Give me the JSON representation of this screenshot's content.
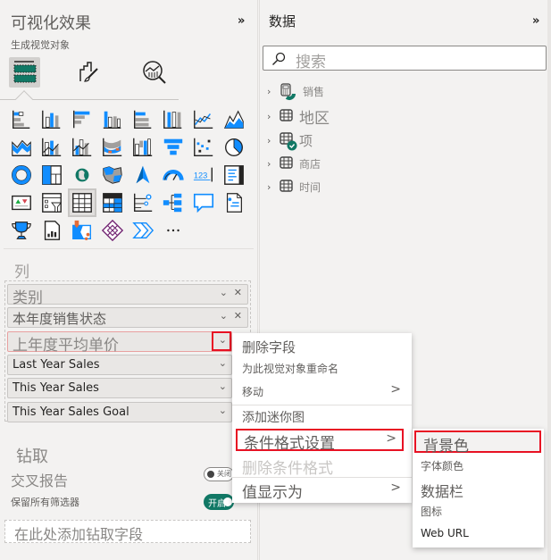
{
  "viz_pane": {
    "title": "可视化效果",
    "subtitle": "生成视觉对象",
    "collapse_icon": "»",
    "tabs": [
      {
        "name": "build-visual",
        "icon": "fields-icon",
        "active": true
      },
      {
        "name": "format-visual",
        "icon": "paint-brush-icon",
        "active": false
      },
      {
        "name": "analytics",
        "icon": "analytics-icon",
        "active": false
      }
    ],
    "visuals": [
      "stacked-bar-chart",
      "stacked-column-chart",
      "clustered-bar-chart",
      "clustered-column-chart",
      "100-stacked-bar-chart",
      "100-stacked-column-chart",
      "line-chart",
      "area-chart",
      "stacked-area-chart",
      "line-and-stacked-column-chart",
      "line-and-clustered-column-chart",
      "ribbon-chart",
      "waterfall-chart",
      "funnel-chart",
      "scatter-chart",
      "pie-chart",
      "donut-chart",
      "treemap",
      "map",
      "filled-map",
      "azure-map",
      "gauge",
      "card",
      "multi-row-card",
      "kpi",
      "slicer",
      "table",
      "matrix",
      "key-influencers",
      "decomposition-tree",
      "qa",
      "smart-narrative",
      "goals",
      "paginated-report",
      "arcgis-map",
      "power-apps",
      "power-automate",
      "more-visuals"
    ],
    "more_label": "...",
    "columns_label": "列",
    "wells": [
      {
        "label": "类别",
        "has_remove": true
      },
      {
        "label": "本年度销售状态",
        "has_remove": true
      },
      {
        "label": "上年度平均单价",
        "has_remove": false
      },
      {
        "label": "Last Year Sales",
        "has_remove": false
      },
      {
        "label": "This Year Sales",
        "has_remove": false
      },
      {
        "label": "This Year Sales Goal",
        "has_remove": false
      }
    ],
    "drill_label": "钻取",
    "cross_report_label": "交叉报告",
    "cross_report_toggle": "关闭",
    "keep_filters_label": "保留所有筛选器",
    "keep_filters_toggle": "开启",
    "drill_placeholder": "在此处添加钻取字段"
  },
  "data_pane": {
    "title": "数据",
    "collapse_icon": "»",
    "search_placeholder": "搜索",
    "tables": [
      {
        "label": "销售",
        "icon": "calculator-table-icon",
        "badge": "partial"
      },
      {
        "label": "地区",
        "icon": "table-icon",
        "badge": "none"
      },
      {
        "label": "项",
        "icon": "table-icon",
        "badge": "check"
      },
      {
        "label": "商店",
        "icon": "table-icon",
        "badge": "none"
      },
      {
        "label": "时间",
        "icon": "table-icon",
        "badge": "none"
      }
    ]
  },
  "context_menu": {
    "items": [
      {
        "label": "删除字段"
      },
      {
        "label": "为此视觉对象重命名"
      },
      {
        "label": "移动",
        "submenu": true
      },
      {
        "label": "添加迷你图"
      },
      {
        "label": "条件格式设置",
        "submenu": true,
        "highlighted": true
      },
      {
        "label": "删除条件格式",
        "disabled": true
      },
      {
        "label": "值显示为",
        "submenu": true
      }
    ],
    "submenu_arrow": ">"
  },
  "submenu": {
    "items": [
      {
        "label": "背景色",
        "highlighted": true
      },
      {
        "label": "字体颜色"
      },
      {
        "label": "数据栏"
      },
      {
        "label": "图标"
      },
      {
        "label": "Web URL"
      }
    ]
  },
  "colors": {
    "accent_blue": "#118dff",
    "teal": "#117865",
    "highlight_red": "#e81123"
  }
}
